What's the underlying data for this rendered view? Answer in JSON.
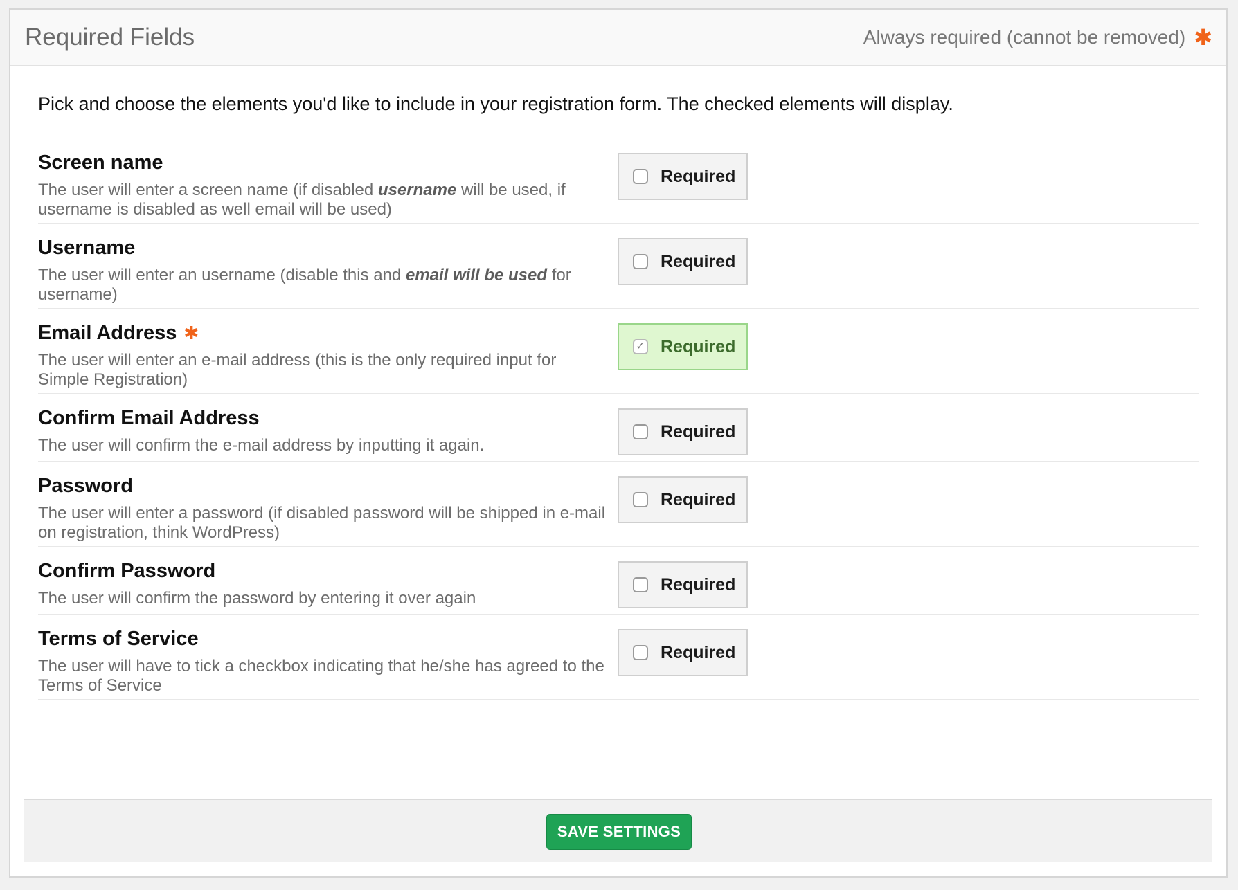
{
  "header": {
    "title": "Required Fields",
    "legend_text": "Always required (cannot be removed)",
    "legend_marker": "✱"
  },
  "intro": "Pick and choose the elements you'd like to include in your registration form. The checked elements will display.",
  "fields": [
    {
      "title": "Screen name",
      "desc_before": "The user will enter a screen name (if disabled ",
      "desc_emph": "username",
      "desc_after": " will be used, if username is disabled as well email will be used)",
      "required_label": "Required",
      "checked": false,
      "always_required": false
    },
    {
      "title": "Username",
      "desc_before": "The user will enter an username (disable this and ",
      "desc_emph": "email will be used",
      "desc_after": " for username)",
      "required_label": "Required",
      "checked": false,
      "always_required": false
    },
    {
      "title": "Email Address",
      "desc_before": "The user will enter an e-mail address (this is the only required input for Simple Registration)",
      "desc_emph": "",
      "desc_after": "",
      "required_label": "Required",
      "checked": true,
      "always_required": true,
      "required_marker": "✱"
    },
    {
      "title": "Confirm Email Address",
      "desc_before": "The user will confirm the e-mail address by inputting it again.",
      "desc_emph": "",
      "desc_after": "",
      "required_label": "Required",
      "checked": false,
      "always_required": false
    },
    {
      "title": "Password",
      "desc_before": "The user will enter a password (if disabled password will be shipped in e-mail on registration, think WordPress)",
      "desc_emph": "",
      "desc_after": "",
      "required_label": "Required",
      "checked": false,
      "always_required": false
    },
    {
      "title": "Confirm Password",
      "desc_before": "The user will confirm the password by entering it over again",
      "desc_emph": "",
      "desc_after": "",
      "required_label": "Required",
      "checked": false,
      "always_required": false
    },
    {
      "title": "Terms of Service",
      "desc_before": "The user will have to tick a checkbox indicating that he/she has agreed to the Terms of Service",
      "desc_emph": "",
      "desc_after": "",
      "required_label": "Required",
      "checked": false,
      "always_required": false
    }
  ],
  "footer": {
    "save_label": "SAVE SETTINGS"
  },
  "colors": {
    "accent_green": "#1fa355",
    "required_marker": "#f0631a",
    "checked_bg": "#dff7d0"
  }
}
